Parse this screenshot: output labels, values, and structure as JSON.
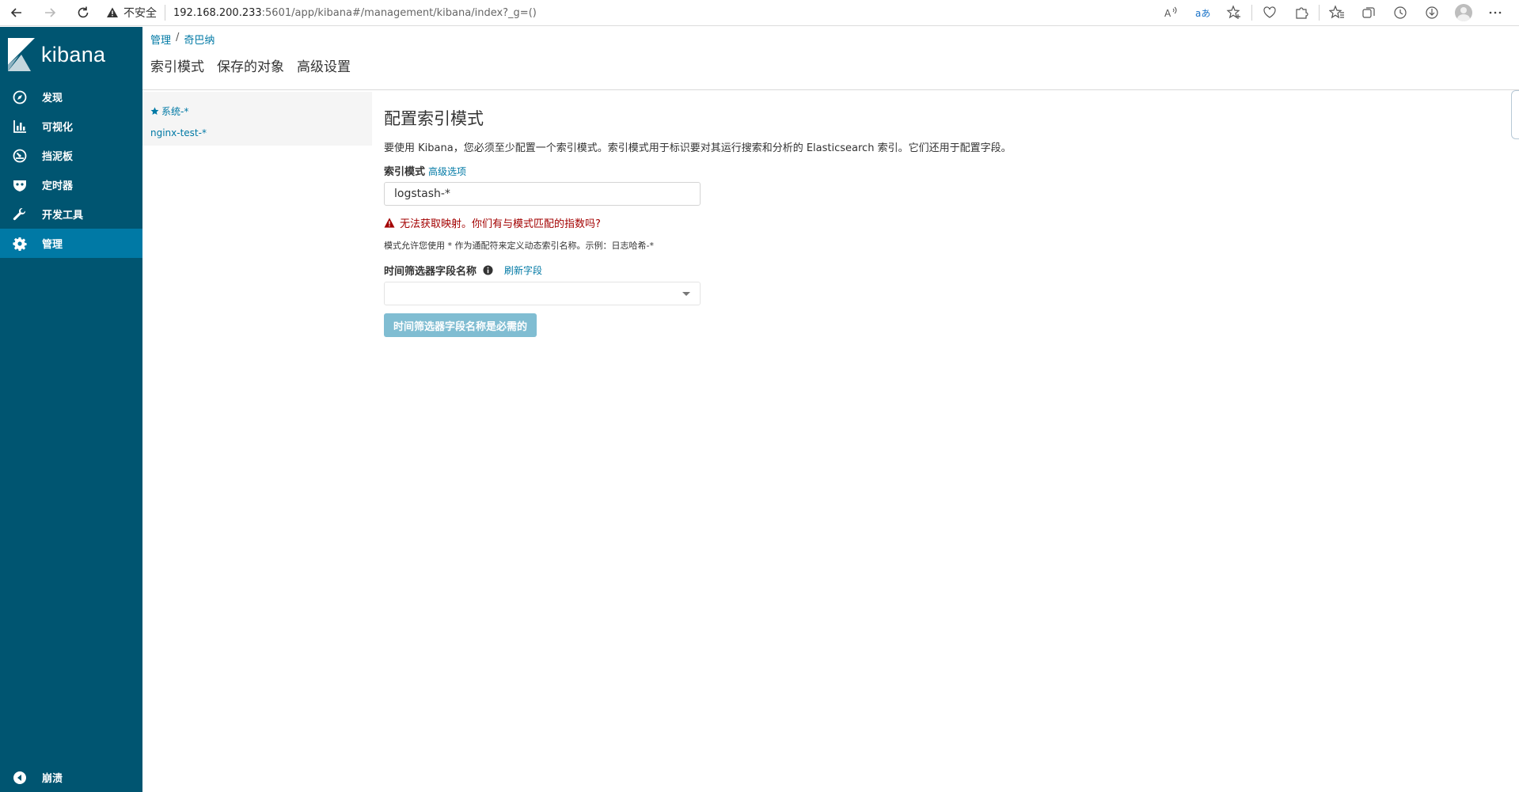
{
  "browser": {
    "security_label": "不安全",
    "url_host": "192.168.200.233",
    "url_rest": ":5601/app/kibana#/management/kibana/index?_g=()"
  },
  "sidebar": {
    "brand": "kibana",
    "items": [
      {
        "label": "发现",
        "icon": "compass-icon"
      },
      {
        "label": "可视化",
        "icon": "bar-chart-icon"
      },
      {
        "label": "挡泥板",
        "icon": "dashboard-icon"
      },
      {
        "label": "定时器",
        "icon": "shield-icon"
      },
      {
        "label": "开发工具",
        "icon": "wrench-icon"
      },
      {
        "label": "管理",
        "icon": "gear-icon"
      }
    ],
    "collapse_label": "崩溃",
    "active_color": "#0079a5",
    "background_color": "#005571"
  },
  "header": {
    "breadcrumb": [
      "管理",
      "奇巴纳"
    ],
    "breadcrumb_sep": "/",
    "tabs": [
      "索引模式",
      "保存的对象",
      "高级设置"
    ]
  },
  "patterns": {
    "items": [
      "系统-*",
      "nginx-test-*"
    ]
  },
  "form": {
    "title": "配置索引模式",
    "description": "要使用 Kibana，您必须至少配置一个索引模式。索引模式用于标识要对其运行搜索和分析的 Elasticsearch 索引。它们还用于配置字段。",
    "index_label": "索引模式",
    "advanced_link": "高级选项",
    "index_value": "logstash-*",
    "error": "无法获取映射。你们有与模式匹配的指数吗?",
    "help": "模式允许您使用 * 作为通配符来定义动态索引名称。示例：日志哈希-*",
    "time_label": "时间筛选器字段名称",
    "refresh_link": "刷新字段",
    "time_value": "",
    "submit_label": "时间筛选器字段名称是必需的"
  }
}
